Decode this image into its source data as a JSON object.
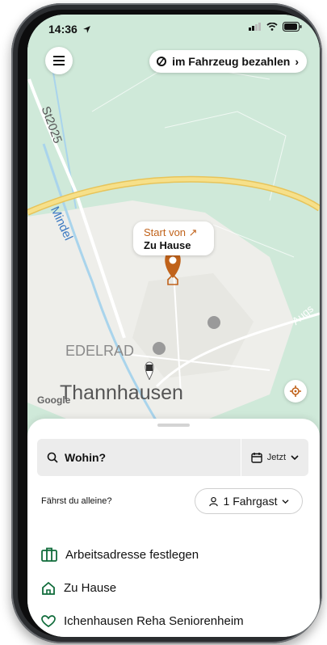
{
  "status": {
    "time": "14:36"
  },
  "header": {
    "pay_label": "im Fahrzeug bezahlen"
  },
  "map": {
    "pin_title": "Start von ↗",
    "pin_subtitle": "Zu Hause",
    "labels": {
      "road1": "St2025",
      "river": "Mindel",
      "road2": "Augs",
      "poi": "EDELRAD",
      "town": "Thannhausen",
      "logo": "Google"
    }
  },
  "sheet": {
    "search_placeholder": "Wohin?",
    "when_label": "Jetzt",
    "alone_question": "Fährst du alleine?",
    "passenger_label": "1 Fahrgast",
    "items": [
      {
        "label": "Arbeitsadresse festlegen",
        "icon": "briefcase-icon"
      },
      {
        "label": "Zu Hause",
        "icon": "home-icon"
      },
      {
        "label": "Ichenhausen Reha Seniorenheim",
        "icon": "heart-icon"
      }
    ]
  },
  "colors": {
    "accent": "#c0621a",
    "map_green": "#cfe9d9",
    "road_yellow": "#f3d56b",
    "brand_green": "#0f6b3a"
  }
}
